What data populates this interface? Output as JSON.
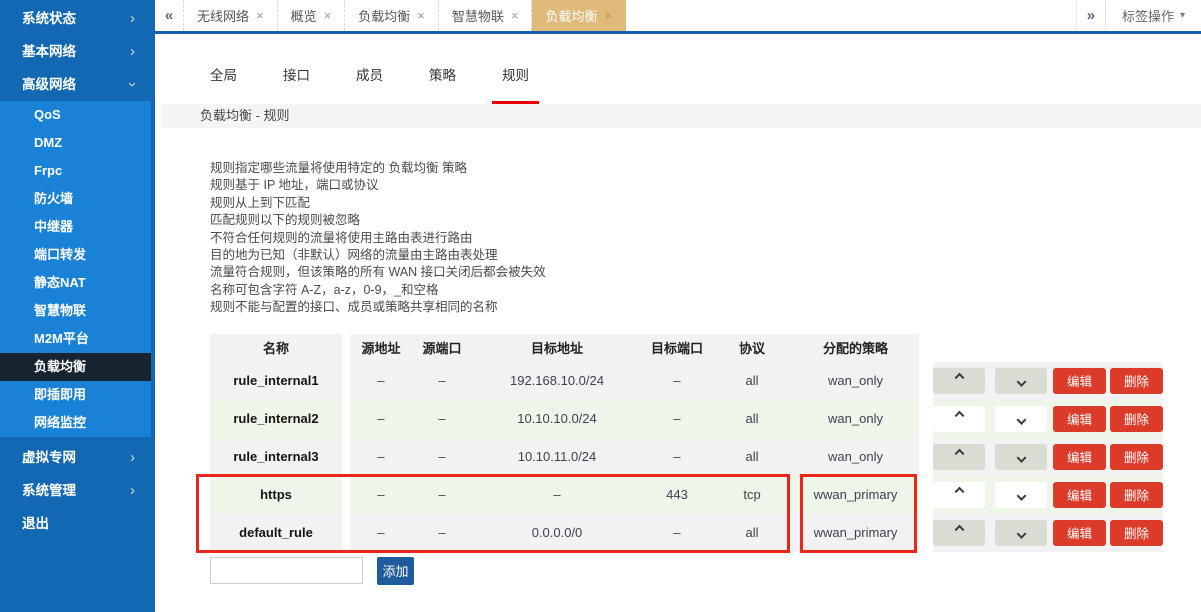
{
  "sidebar": {
    "top_items": [
      {
        "label": "系统状态"
      },
      {
        "label": "基本网络"
      },
      {
        "label": "高级网络"
      }
    ],
    "submenu": [
      "QoS",
      "DMZ",
      "Frpc",
      "防火墙",
      "中继器",
      "端口转发",
      "静态NAT",
      "智慧物联",
      "M2M平台",
      "负载均衡",
      "即插即用",
      "网络监控"
    ],
    "active_submenu": "负载均衡",
    "bottom_items": [
      {
        "label": "虚拟专网"
      },
      {
        "label": "系统管理"
      },
      {
        "label": "退出"
      }
    ],
    "chevron_collapsed": "›"
  },
  "tabbar": {
    "scroll_left": "«",
    "scroll_right": "»",
    "close_glyph": "×",
    "tabs": [
      {
        "label": "无线网络"
      },
      {
        "label": "概览"
      },
      {
        "label": "负载均衡"
      },
      {
        "label": "智慧物联"
      },
      {
        "label": "负载均衡"
      }
    ],
    "active_tab_index": 4,
    "actions_label": "标签操作",
    "caret": "▾"
  },
  "subtabs": [
    "全局",
    "接口",
    "成员",
    "策略",
    "规则"
  ],
  "active_subtab": "规则",
  "page_title": "负载均衡 - 规则",
  "description_lines": [
    "规则指定哪些流量将使用特定的 负载均衡 策略",
    "规则基于 IP 地址，端口或协议",
    "规则从上到下匹配",
    "匹配规则以下的规则被忽略",
    "不符合任何规则的流量将使用主路由表进行路由",
    "目的地为已知（非默认）网络的流量由主路由表处理",
    "流量符合规则，但该策略的所有 WAN 接口关闭后都会被失效",
    "名称可包含字符 A-Z，a-z，0-9，_和空格",
    "规则不能与配置的接口、成员或策略共享相同的名称"
  ],
  "table": {
    "headers": [
      "名称",
      "源地址",
      "源端口",
      "目标地址",
      "目标端口",
      "协议",
      "分配的策略"
    ],
    "rows": [
      {
        "name": "rule_internal1",
        "src_addr": "–",
        "src_port": "–",
        "dst_addr": "192.168.10.0/24",
        "dst_port": "–",
        "proto": "all",
        "policy": "wan_only"
      },
      {
        "name": "rule_internal2",
        "src_addr": "–",
        "src_port": "–",
        "dst_addr": "10.10.10.0/24",
        "dst_port": "–",
        "proto": "all",
        "policy": "wan_only"
      },
      {
        "name": "rule_internal3",
        "src_addr": "–",
        "src_port": "–",
        "dst_addr": "10.10.11.0/24",
        "dst_port": "–",
        "proto": "all",
        "policy": "wan_only"
      },
      {
        "name": "https",
        "src_addr": "–",
        "src_port": "–",
        "dst_addr": "–",
        "dst_port": "443",
        "proto": "tcp",
        "policy": "wwan_primary"
      },
      {
        "name": "default_rule",
        "src_addr": "–",
        "src_port": "–",
        "dst_addr": "0.0.0.0/0",
        "dst_port": "–",
        "proto": "all",
        "policy": "wwan_primary"
      }
    ],
    "row_actions": {
      "edit": "编辑",
      "delete": "删除"
    },
    "highlighted_rows": [
      "https",
      "default_rule"
    ]
  },
  "add": {
    "input_value": "",
    "input_placeholder": "",
    "button_label": "添加"
  },
  "colors": {
    "sidebar_blue": "#1268b3",
    "submenu_blue": "#1a82d6",
    "selected_dark": "#182430",
    "active_tab_tan": "#dfba7a",
    "tabbar_border_blue": "#1a5fa8",
    "danger_red": "#dc3b2a",
    "highlight_red": "#e8271b",
    "add_button_blue": "#1e5c9e",
    "row_green": "#eef5e9",
    "row_gray": "#f2f2f2",
    "subtab_underline_red": "#e60000"
  }
}
